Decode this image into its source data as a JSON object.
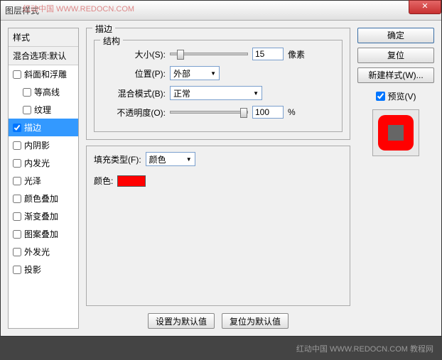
{
  "titlebar": {
    "title": "图层样式",
    "close": "✕"
  },
  "watermark": {
    "top": "红动中国  WWW.REDOCN.COM",
    "bottom": "红动中国  WWW.REDOCN.COM  教程网"
  },
  "left": {
    "header": "样式",
    "subheader": "混合选项:默认",
    "items": [
      {
        "label": "斜面和浮雕",
        "checked": false,
        "indent": false
      },
      {
        "label": "等高线",
        "checked": false,
        "indent": true
      },
      {
        "label": "纹理",
        "checked": false,
        "indent": true
      },
      {
        "label": "描边",
        "checked": true,
        "indent": false,
        "selected": true
      },
      {
        "label": "内阴影",
        "checked": false,
        "indent": false
      },
      {
        "label": "内发光",
        "checked": false,
        "indent": false
      },
      {
        "label": "光泽",
        "checked": false,
        "indent": false
      },
      {
        "label": "颜色叠加",
        "checked": false,
        "indent": false
      },
      {
        "label": "渐变叠加",
        "checked": false,
        "indent": false
      },
      {
        "label": "图案叠加",
        "checked": false,
        "indent": false
      },
      {
        "label": "外发光",
        "checked": false,
        "indent": false
      },
      {
        "label": "投影",
        "checked": false,
        "indent": false
      }
    ]
  },
  "center": {
    "title": "描边",
    "structure": {
      "title": "结构",
      "size_label": "大小(S):",
      "size_value": "15",
      "size_unit": "像素",
      "position_label": "位置(P):",
      "position_value": "外部",
      "blend_label": "混合模式(B):",
      "blend_value": "正常",
      "opacity_label": "不透明度(O):",
      "opacity_value": "100",
      "opacity_unit": "%"
    },
    "fill": {
      "type_label": "填充类型(F):",
      "type_value": "颜色",
      "color_label": "颜色:",
      "color_value": "#ff0000"
    },
    "buttons": {
      "default": "设置为默认值",
      "reset": "复位为默认值"
    }
  },
  "right": {
    "ok": "确定",
    "reset": "复位",
    "new_style": "新建样式(W)...",
    "preview_label": "预览(V)",
    "preview_checked": true
  }
}
